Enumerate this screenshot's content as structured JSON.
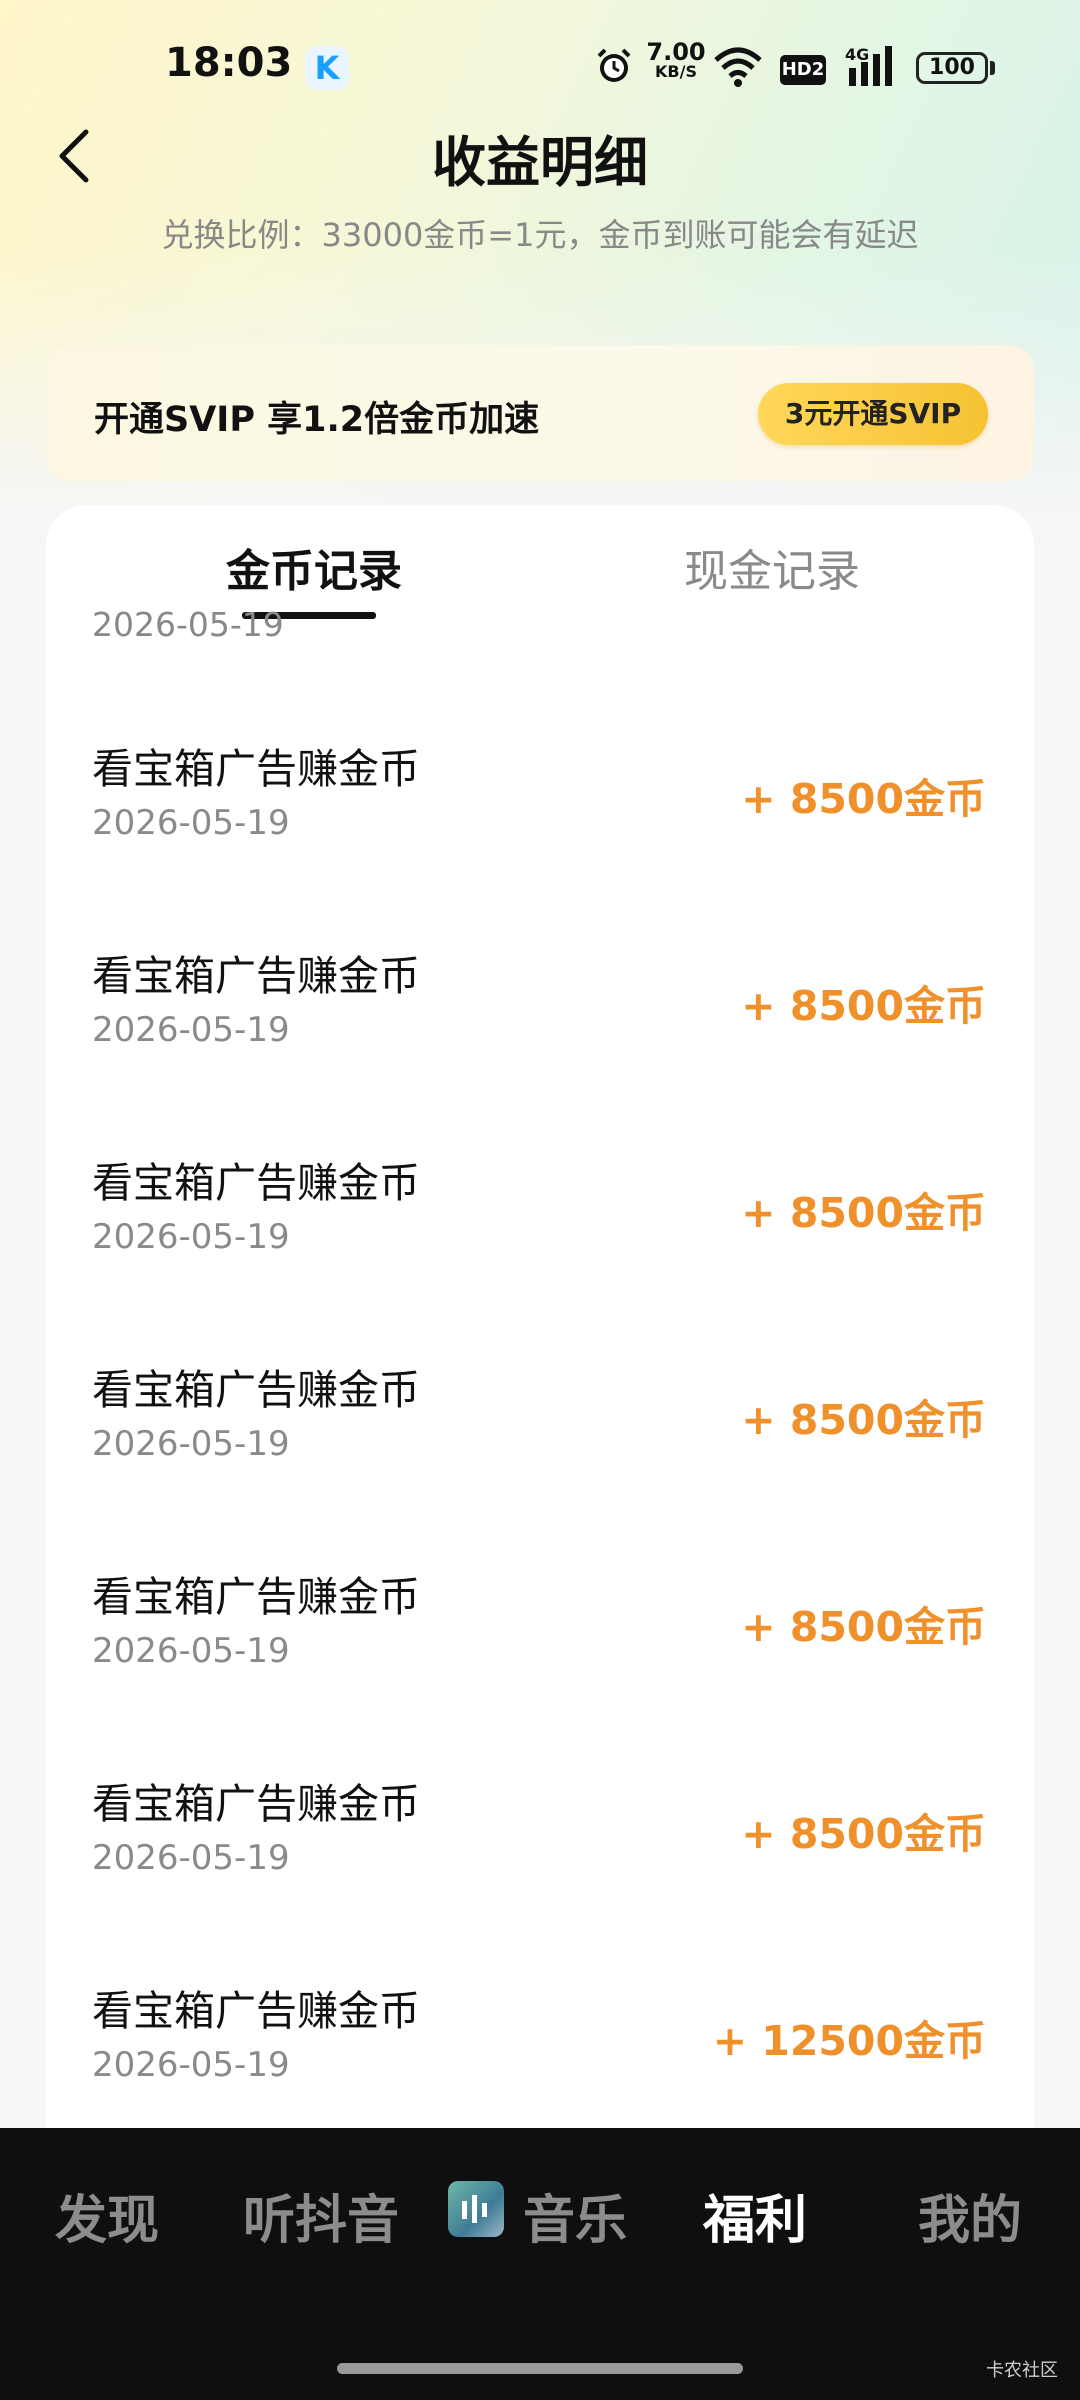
{
  "status_bar": {
    "time": "18:03",
    "app_icon_letter": "K",
    "net_speed_value": "7.00",
    "net_speed_unit": "KB/S",
    "hd_badge": "HD2",
    "network": "4G",
    "battery": "100"
  },
  "header": {
    "title": "收益明细",
    "subtitle": "兑换比例：33000金币=1元，金币到账可能会有延迟"
  },
  "svip_banner": {
    "text": "开通SVIP 享1.2倍金币加速",
    "button_label": "3元开通SVIP"
  },
  "tabs": [
    {
      "label": "金币记录",
      "active": true
    },
    {
      "label": "现金记录",
      "active": false
    }
  ],
  "partial_top_date": "2026-05-19",
  "records": [
    {
      "title": "看宝箱广告赚金币",
      "date": "2026-05-19",
      "amount": "+ 8500金币"
    },
    {
      "title": "看宝箱广告赚金币",
      "date": "2026-05-19",
      "amount": "+ 8500金币"
    },
    {
      "title": "看宝箱广告赚金币",
      "date": "2026-05-19",
      "amount": "+ 8500金币"
    },
    {
      "title": "看宝箱广告赚金币",
      "date": "2026-05-19",
      "amount": "+ 8500金币"
    },
    {
      "title": "看宝箱广告赚金币",
      "date": "2026-05-19",
      "amount": "+ 8500金币"
    },
    {
      "title": "看宝箱广告赚金币",
      "date": "2026-05-19",
      "amount": "+ 8500金币"
    },
    {
      "title": "看宝箱广告赚金币",
      "date": "2026-05-19",
      "amount": "+ 12500金币"
    }
  ],
  "bottom_nav": [
    {
      "label": "发现",
      "active": false
    },
    {
      "label": "听抖音",
      "active": false
    },
    {
      "label": "音乐",
      "active": false
    },
    {
      "label": "福利",
      "active": true
    },
    {
      "label": "我的",
      "active": false
    }
  ],
  "watermark": "卡农社区",
  "colors": {
    "amount": "#f0902a",
    "nav_background": "#0f0f0f",
    "svip_button": "#f6c233"
  }
}
